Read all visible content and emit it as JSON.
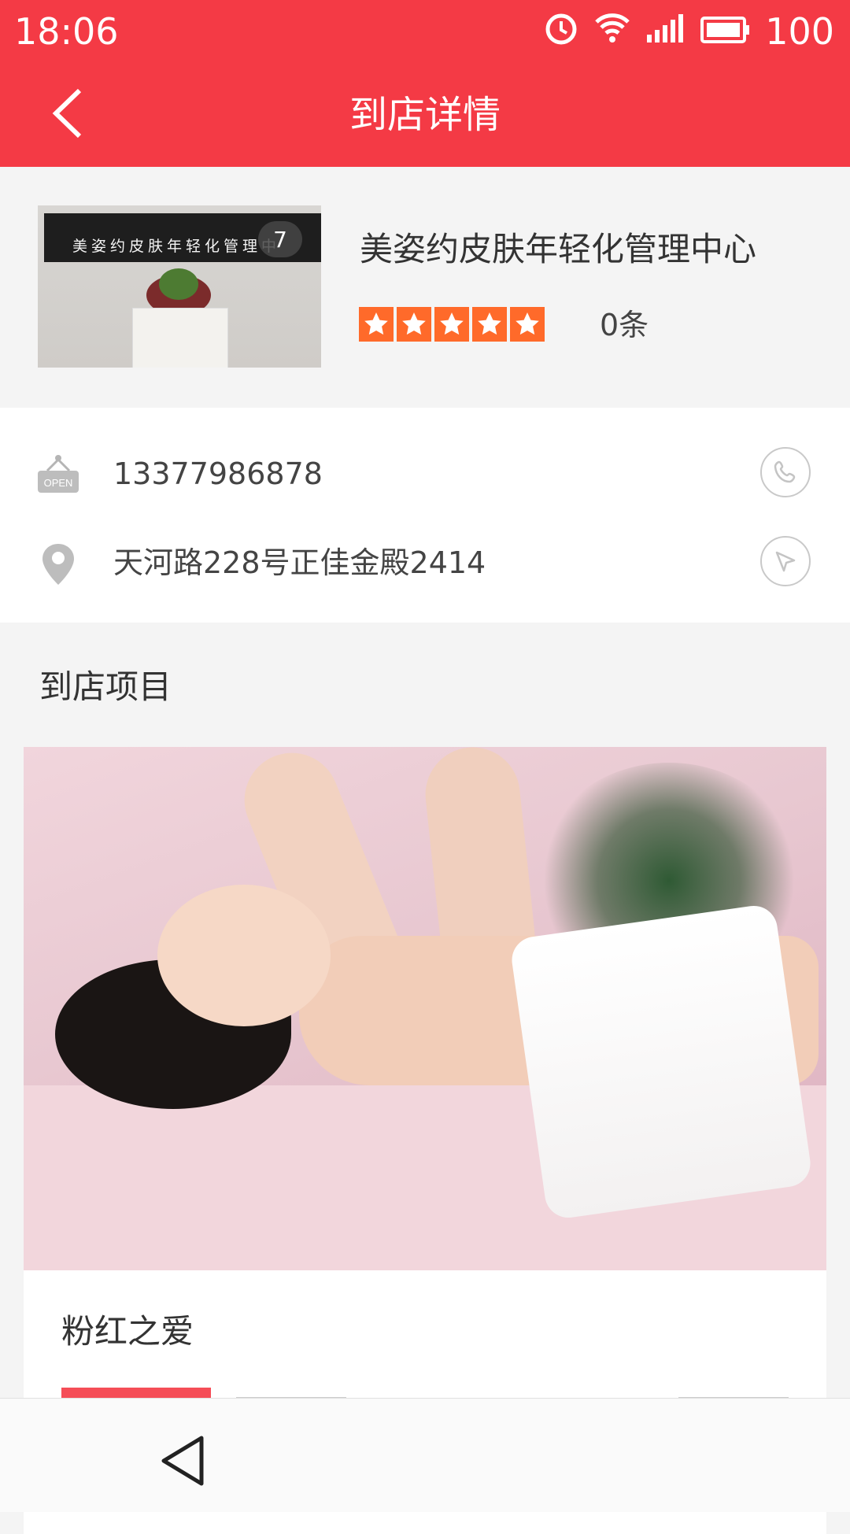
{
  "status_bar": {
    "time": "18:06",
    "battery": "100"
  },
  "header": {
    "title": "到店详情"
  },
  "shop": {
    "name": "美姿约皮肤年轻化管理中心",
    "photo_count": "7",
    "sign_text": "美姿约皮肤年轻化管理中",
    "rating": 5,
    "review_count": "0条"
  },
  "info": {
    "phone": "13377986878",
    "address": "天河路228号正佳金殿2414"
  },
  "section": {
    "title": "到店项目"
  },
  "project": {
    "name": "粉红之爱"
  },
  "colors": {
    "header": "#f43a45",
    "star": "#ff6a2a"
  }
}
